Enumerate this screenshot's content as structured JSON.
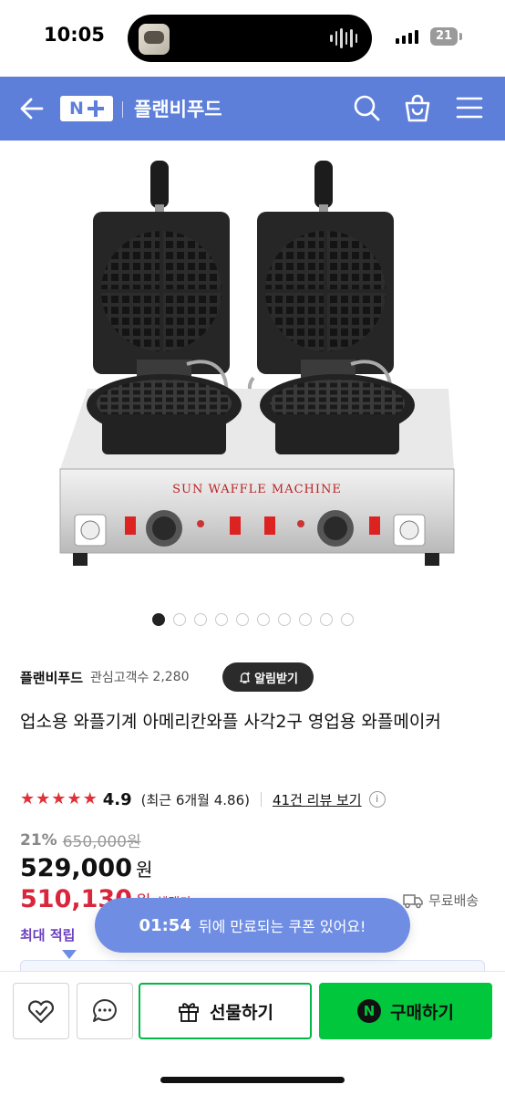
{
  "status_bar": {
    "time": "10:05",
    "battery": "21"
  },
  "header": {
    "logo_text": "N",
    "store_name": "플랜비푸드"
  },
  "gallery": {
    "image_label": "SUN WAFFLE MACHINE",
    "total_images": 10,
    "active_index": 0
  },
  "seller": {
    "name": "플랜비푸드",
    "followers_label": "관심고객수",
    "followers_count": "2,280",
    "alert_button": "알림받기"
  },
  "product": {
    "title": "업소용 와플기계 아메리칸와플 사각2구 영업용 와플메이커"
  },
  "rating": {
    "stars": 5,
    "value": "4.9",
    "recent": "(최근 6개월 4.86)",
    "review_link": "41건 리뷰 보기",
    "info_icon": "i"
  },
  "pricing": {
    "discount_rate": "21%",
    "original_price": "650,000원",
    "price": "529,000",
    "price_unit": "원",
    "benefit_price": "510,130",
    "benefit_unit": "원",
    "benefit_label": "혜택가",
    "shipping": "무료배송",
    "points": "최대 적립"
  },
  "coupon_toast": {
    "timer": "01:54",
    "text": "뒤에 만료되는 쿠폰 있어요!"
  },
  "bottom_bar": {
    "gift_label": "선물하기",
    "buy_label": "구매하기",
    "npay_letter": "N"
  },
  "colors": {
    "header_bg": "#5d7fda",
    "buy_green": "#00c73c",
    "benefit_red": "#d9263c",
    "star_red": "#e0323b",
    "points_purple": "#6b3fbf"
  }
}
